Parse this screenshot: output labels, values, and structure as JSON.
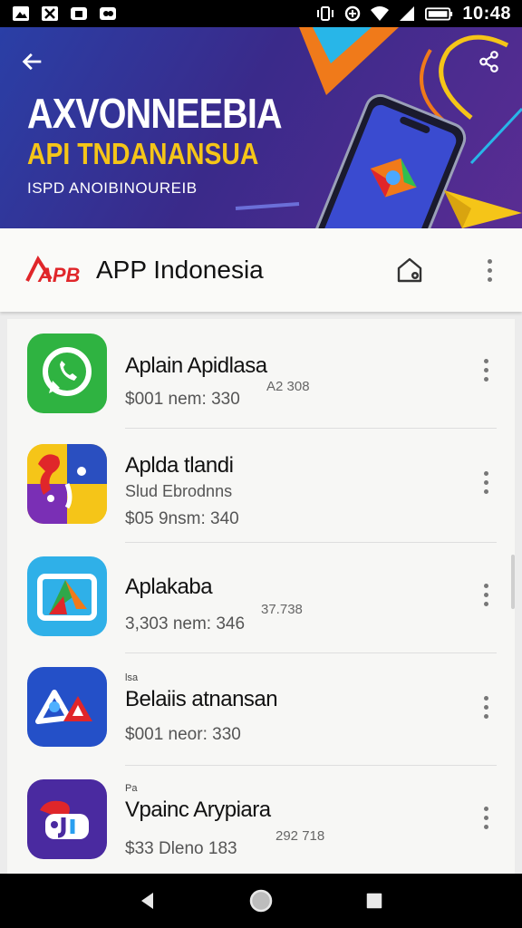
{
  "status_bar": {
    "time": "10:48",
    "left_icons": [
      "image-notification-icon",
      "x-notification-icon",
      "media-notification-icon",
      "cast-notification-icon"
    ],
    "right_icons": [
      "vibrate-icon",
      "data-saver-icon",
      "wifi-icon",
      "signal-icon",
      "battery-icon"
    ]
  },
  "banner": {
    "title": "AXVONNEEBIA",
    "subtitle": "API TNDANANSUA",
    "tagline": "ISPD ANOIBINOUREIB",
    "colors": {
      "background": "#2f3596",
      "accent_yellow": "#f5c518",
      "accent_orange": "#f07a1a",
      "accent_cyan": "#28b6e8"
    }
  },
  "header": {
    "app_name": "APP Indonesia",
    "logo_text": "APB",
    "logo_color": "#e0262a"
  },
  "apps": [
    {
      "title": "Aplain Apidlasa",
      "subtitle": "",
      "meta": "$001 nem:  330",
      "extra": "A2 308",
      "tiny": "",
      "icon": "whatsapp-style-icon"
    },
    {
      "title": "Aplda tlandi",
      "subtitle": "Slud Ebrodnns",
      "meta": "$05 9nsm:  340",
      "extra": "",
      "tiny": "",
      "icon": "colorful-puzzle-icon"
    },
    {
      "title": "Aplakaba",
      "subtitle": "",
      "meta": "3,303 nem:  346",
      "extra": "37.738",
      "tiny": "",
      "icon": "drive-style-icon"
    },
    {
      "title": "Belaiis atnansan",
      "subtitle": "",
      "meta": "$001 neor:  330",
      "extra": "",
      "tiny": "lsa",
      "icon": "blue-shapes-icon"
    },
    {
      "title": "Vpainc Arypiara",
      "subtitle": "",
      "meta": "$33 Dleno  183",
      "extra": "292 718",
      "tiny": "Pa",
      "icon": "purple-logo-icon"
    }
  ]
}
